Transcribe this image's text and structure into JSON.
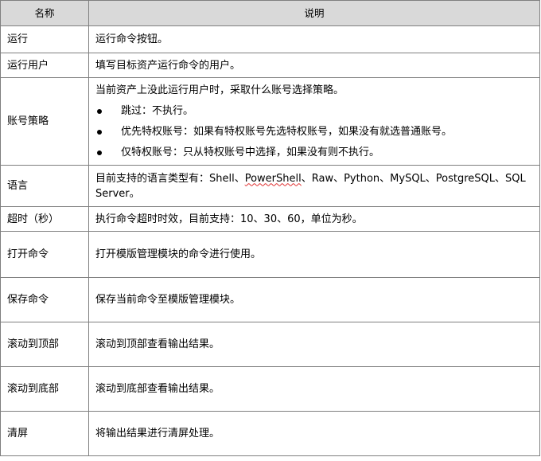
{
  "header": {
    "col_name": "名称",
    "col_desc": "说明"
  },
  "rows": [
    {
      "name": "运行",
      "desc": "运行命令按钮。"
    },
    {
      "name": "运行用户",
      "desc": "填写目标资产运行命令的用户。"
    },
    {
      "name": "账号策略",
      "desc": "当前资产上没此运行用户时，采取什么账号选择策略。",
      "bullets": [
        "跳过：不执行。",
        "优先特权账号：如果有特权账号先选特权账号，如果没有就选普通账号。",
        "仅特权账号：只从特权账号中选择，如果没有则不执行。"
      ]
    },
    {
      "name": "语言",
      "desc_prefix": "目前支持的语言类型有：Shell、",
      "desc_flagged": "PowerShell",
      "desc_suffix": "、Raw、Python、MySQL、PostgreSQL、SQL Server。"
    },
    {
      "name": "超时（秒）",
      "desc": "执行命令超时时效，目前支持：10、30、60，单位为秒。"
    },
    {
      "name": "打开命令",
      "desc": "打开模版管理模块的命令进行使用。"
    },
    {
      "name": "保存命令",
      "desc": "保存当前命令至模版管理模块。"
    },
    {
      "name": "滚动到顶部",
      "desc": "滚动到顶部查看输出结果。"
    },
    {
      "name": "滚动到底部",
      "desc": "滚动到底部查看输出结果。"
    },
    {
      "name": "清屏",
      "desc": "将输出结果进行清屏处理。"
    }
  ],
  "colors": {
    "header_bg": "#d9d9d9",
    "border": "#7f7f7f",
    "spellcheck": "#e03030"
  }
}
